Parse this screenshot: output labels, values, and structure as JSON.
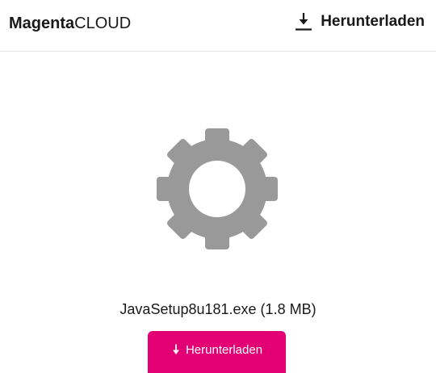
{
  "header": {
    "logo_bold": "Magenta",
    "logo_light": "CLOUD",
    "download_label": "Herunterladen",
    "download_icon": "download-icon"
  },
  "main": {
    "file_icon": "gear-icon",
    "file_label": "JavaSetup8u181.exe (1.8 MB)",
    "download_button_label": "Herunterladen",
    "download_button_icon": "arrow-down-icon"
  },
  "colors": {
    "brand": "#e20074",
    "gear": "#999999",
    "text": "#191919",
    "divider": "#e6e6e6"
  }
}
